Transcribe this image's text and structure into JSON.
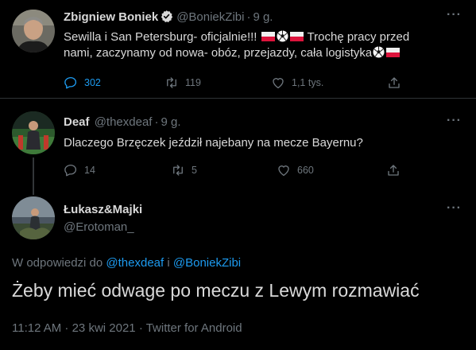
{
  "tweets": [
    {
      "name": "Zbigniew Boniek",
      "handle": "@BoniekZibi",
      "separator": "·",
      "time": "9 g.",
      "verified": true,
      "text_line1": "Sewilla i San Petersburg- oficjalnie!!!",
      "text_line1_b": "Trochę pracy przed",
      "text_line2": "nami, zaczynamy od nowa- obóz, przejazdy, cała logistyka",
      "reply_count": "302",
      "retweet_count": "119",
      "like_count": "1,1 tys."
    },
    {
      "name": "Deaf",
      "handle": "@thexdeaf",
      "separator": "·",
      "time": "9 g.",
      "text": "Dlaczego Brzęczek jeździł najebany na mecze Bayernu?",
      "reply_count": "14",
      "retweet_count": "5",
      "like_count": "660"
    }
  ],
  "focus": {
    "name": "Łukasz&Majki",
    "handle": "@Erotoman_",
    "reply_prefix": "W odpowiedzi do",
    "reply_mention1": "@thexdeaf",
    "reply_and": "i",
    "reply_mention2": "@BoniekZibi",
    "text": "Żeby mieć odwage po meczu z Lewym rozmawiać",
    "meta": "11:12 AM · 23 kwi 2021 · Twitter for Android"
  },
  "more_label": "···",
  "colors": {
    "background": "#000000",
    "text": "#d9d9d9",
    "muted": "#6e767d",
    "accent": "#1d9bf0"
  },
  "icons": [
    "verified-icon",
    "reply-icon",
    "retweet-icon",
    "like-icon",
    "share-icon",
    "more-icon",
    "poland-flag-icon",
    "soccer-ball-icon"
  ]
}
